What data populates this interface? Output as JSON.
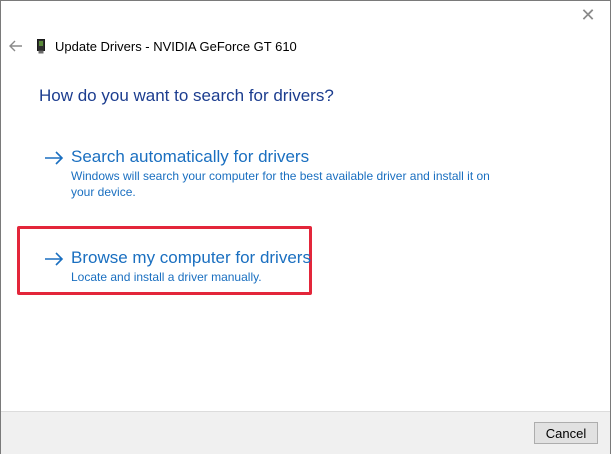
{
  "window": {
    "close_glyph": "✕"
  },
  "titlebar": {
    "back_icon": "back-arrow-icon",
    "device_icon": "graphics-card-icon",
    "title": "Update Drivers - NVIDIA GeForce GT 610"
  },
  "main": {
    "heading": "How do you want to search for drivers?",
    "options": [
      {
        "icon": "right-arrow-icon",
        "label": "Search automatically for drivers",
        "description": "Windows will search your computer for the best available driver and install it on your device."
      },
      {
        "icon": "right-arrow-icon",
        "label": "Browse my computer for drivers",
        "description": "Locate and install a driver manually."
      }
    ]
  },
  "footer": {
    "cancel_label": "Cancel"
  },
  "colors": {
    "heading": "#1c3d8f",
    "link": "#1a6fc0",
    "highlight": "#e3263a"
  }
}
